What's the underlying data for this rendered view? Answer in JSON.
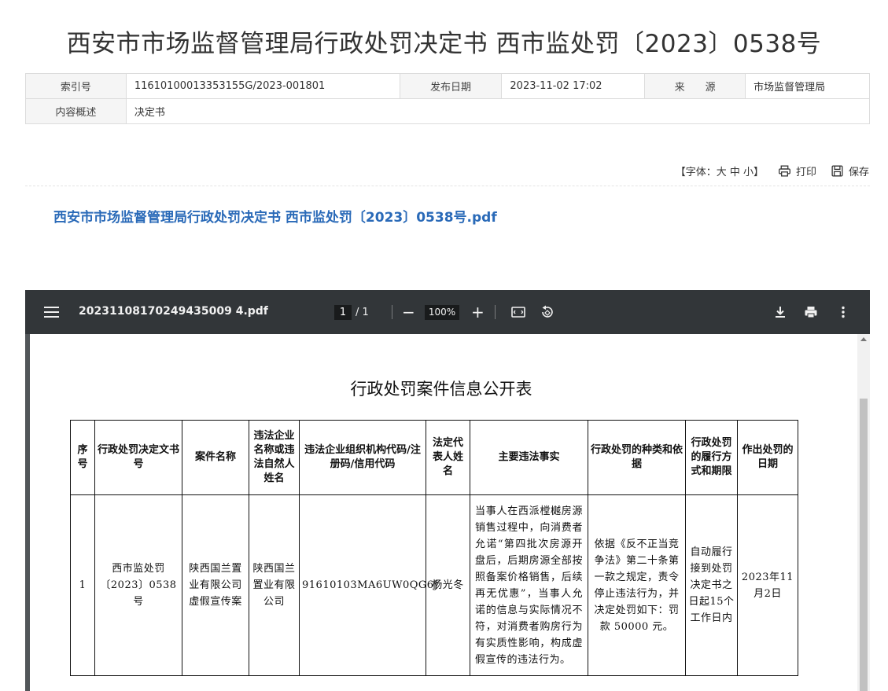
{
  "page": {
    "title": "西安市市场监督管理局行政处罚决定书 西市监处罚〔2023〕0538号"
  },
  "meta": {
    "index_label": "索引号",
    "index_value": "11610100013353155G/2023-001801",
    "date_label": "发布日期",
    "date_value": "2023-11-02 17:02",
    "source_label": "来　　源",
    "source_value": "市场监督管理局",
    "summary_label": "内容概述",
    "summary_value": "决定书"
  },
  "tools": {
    "font_size_label": "【字体：大 中 小】",
    "print_label": "打印",
    "save_label": "保存"
  },
  "attachment": {
    "link_text": "西安市市场监督管理局行政处罚决定书 西市监处罚〔2023〕0538号.pdf"
  },
  "viewer": {
    "filename": "20231108170249435009 4.pdf",
    "page_current": "1",
    "page_total": "/ 1",
    "zoom": "100%",
    "icons": [
      "menu-icon",
      "zoom-out-icon",
      "zoom-in-icon",
      "fit-page-icon",
      "rotate-icon",
      "download-icon",
      "print-icon",
      "more-icon"
    ]
  },
  "document": {
    "title": "行政处罚案件信息公开表",
    "headers": [
      "序号",
      "行政处罚决定文书号",
      "案件名称",
      "违法企业名称或违法自然人姓名",
      "违法企业组织机构代码/注册码/信用代码",
      "法定代表人姓名",
      "主要违法事实",
      "行政处罚的种类和依据",
      "行政处罚的履行方式和期限",
      "作出处罚的日期"
    ],
    "row": {
      "seq": "1",
      "doc_no": "西市监处罚〔2023〕0538号",
      "case_name": "陕西国兰置业有限公司虚假宣传案",
      "company": "陕西国兰置业有限公司",
      "credit_code": "91610103MA6UW0QG6J",
      "legal_rep": "杨光冬",
      "facts": "当事人在西派樘樾房源销售过程中，向消费者允诺“第四批次房源开盘后，后期房源全部按照备案价格销售，后续再无优惠”，当事人允诺的信息与实际情况不符，对消费者购房行为有实质性影响，构成虚假宣传的违法行为。",
      "penalty": "依据《反不正当竞争法》第二十条第一款之规定，责令停止违法行为，并决定处罚如下：罚款 50000 元。",
      "execution": "自动履行接到处罚决定书之日起15个工作日内",
      "date": "2023年11月2日"
    }
  }
}
